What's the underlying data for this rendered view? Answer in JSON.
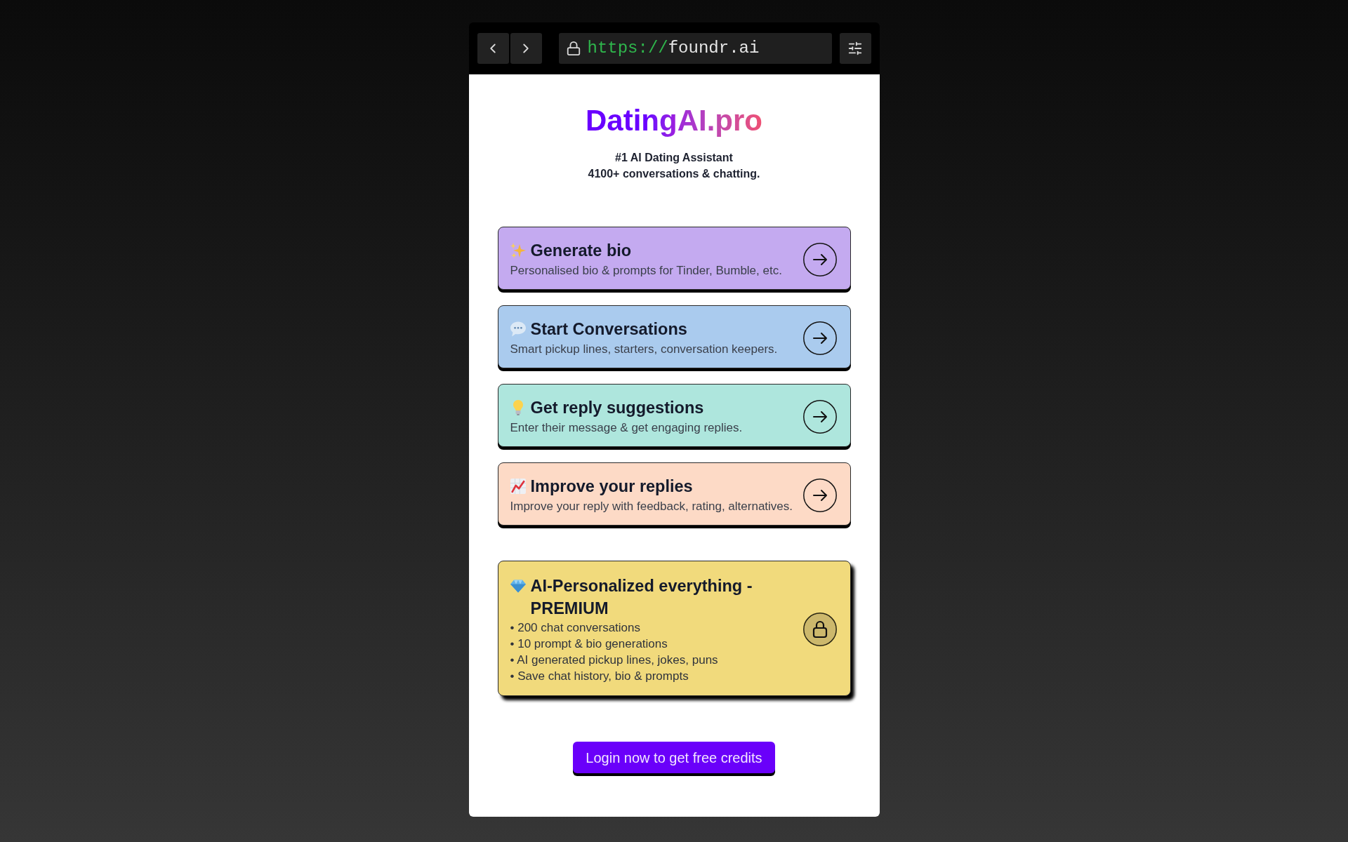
{
  "browser": {
    "url_scheme": "https://",
    "url_host": "foundr.ai"
  },
  "page": {
    "title": "DatingAI.pro",
    "tagline": [
      "#1 AI Dating Assistant",
      "4100+ conversations & chatting."
    ]
  },
  "features": [
    {
      "title": "Generate bio",
      "description": "Personalised bio & prompts for Tinder, Bumble, etc.",
      "color": "#c4aaf0"
    },
    {
      "title": "Start Conversations",
      "description": "Smart pickup lines, starters, conversation keepers.",
      "color": "#aacbee"
    },
    {
      "title": "Get reply suggestions",
      "description": "Enter their message & get engaging replies.",
      "color": "#aee6dd"
    },
    {
      "title": "Improve your replies",
      "description": "Improve your reply with feedback, rating, alternatives.",
      "color": "#fddac6"
    }
  ],
  "premium": {
    "title": "AI-Personalized everything - PREMIUM",
    "locked": true,
    "features": [
      "• 200 chat conversations",
      "• 10 prompt & bio generations",
      "• AI generated pickup lines, jokes, puns",
      "• Save chat history, bio & prompts"
    ]
  },
  "login_button": "Login now to get free credits"
}
